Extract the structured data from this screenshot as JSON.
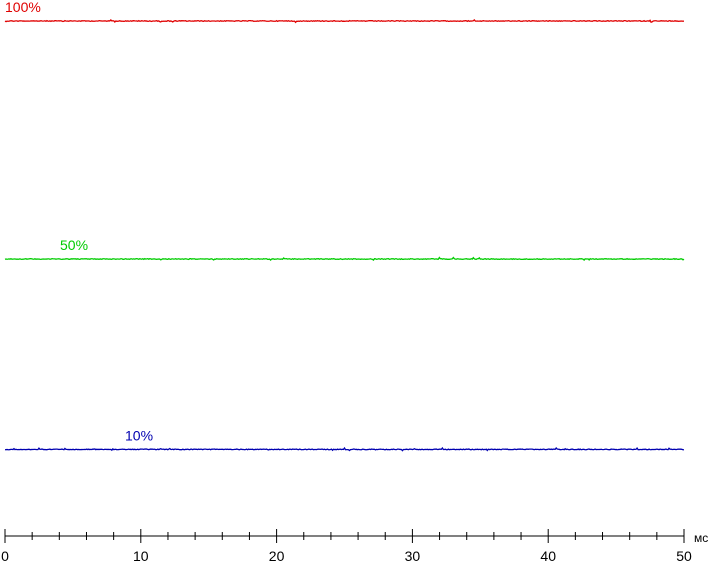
{
  "chart_data": {
    "type": "line",
    "x_unit": "мс",
    "xlim": [
      0,
      50
    ],
    "x_ticks": [
      0,
      10,
      20,
      30,
      40,
      50
    ],
    "x_minor_step": 2,
    "ylim": [
      0,
      100
    ],
    "grid": false,
    "series": [
      {
        "name": "100%",
        "level": 100,
        "color": "#e00000",
        "noise": 0.35
      },
      {
        "name": "50%",
        "level": 50,
        "color": "#00cc00",
        "noise": 0.35
      },
      {
        "name": "10%",
        "level": 10,
        "color": "#0000b0",
        "noise": 0.35
      }
    ]
  }
}
